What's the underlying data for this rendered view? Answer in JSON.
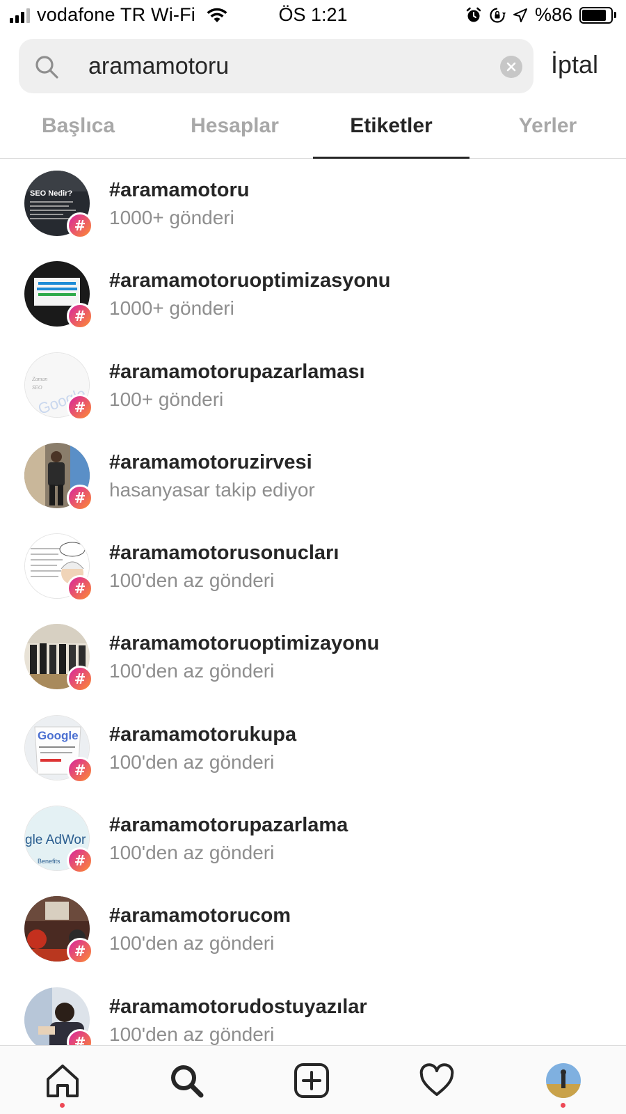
{
  "status_bar": {
    "carrier": "vodafone TR Wi-Fi",
    "time": "ÖS 1:21",
    "battery": "%86",
    "battery_level": 0.86
  },
  "search": {
    "query": "aramamotoru",
    "cancel_label": "İptal"
  },
  "tabs": [
    {
      "label": "Başlıca",
      "active": false
    },
    {
      "label": "Hesaplar",
      "active": false
    },
    {
      "label": "Etiketler",
      "active": true
    },
    {
      "label": "Yerler",
      "active": false
    }
  ],
  "hashtags": [
    {
      "tag": "#aramamotoru",
      "subtitle": "1000+ gönderi"
    },
    {
      "tag": "#aramamotoruoptimizasyonu",
      "subtitle": "1000+ gönderi"
    },
    {
      "tag": "#aramamotorupazarlaması",
      "subtitle": "100+ gönderi"
    },
    {
      "tag": "#aramamotoruzirvesi",
      "subtitle": "hasanyasar takip ediyor"
    },
    {
      "tag": "#aramamotorusonucları",
      "subtitle": "100'den az gönderi"
    },
    {
      "tag": "#aramamotoruoptimizayonu",
      "subtitle": "100'den az gönderi"
    },
    {
      "tag": "#aramamotorukupa",
      "subtitle": "100'den az gönderi"
    },
    {
      "tag": "#aramamotorupazarlama",
      "subtitle": "100'den az gönderi"
    },
    {
      "tag": "#aramamotorucom",
      "subtitle": "100'den az gönderi"
    },
    {
      "tag": "#aramamotorudostuyazılar",
      "subtitle": "100'den az gönderi"
    }
  ],
  "thumb_text": {
    "seo": "SEO Nedir?",
    "google": "Google",
    "adwords": "gle AdWor",
    "benefits": "Benefits"
  },
  "colors": {
    "badge_gradient_start": "#d6249f",
    "badge_gradient_end": "#fd8d32",
    "active_text": "#262626",
    "inactive_tab": "#a8a8a8",
    "notification_dot": "#ed4956"
  },
  "nav": [
    "home-icon",
    "search-icon",
    "new-post-icon",
    "activity-heart-icon",
    "profile-avatar"
  ]
}
